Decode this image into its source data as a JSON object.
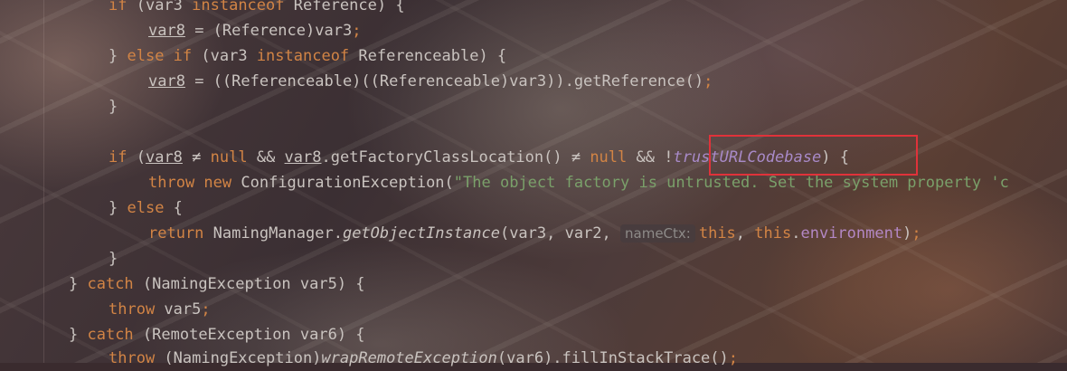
{
  "code": {
    "l1_if": "if",
    "l1_var3": " (var3 ",
    "l1_instanceof": "instanceof",
    "l1_ref": " Reference) {",
    "l2_var8": "var8",
    "l2_rest": " = (Reference)var3",
    "l2_semi": ";",
    "l3_close": "} ",
    "l3_else": "else",
    "l3_if": " if",
    "l3_var3": " (var3 ",
    "l3_instanceof": "instanceof",
    "l3_refable": " Referenceable) {",
    "l4_var8": "var8",
    "l4_rest": " = ((Referenceable)((Referenceable)var3)).getReference()",
    "l4_semi": ";",
    "l5_close": "}",
    "l6_if": "if",
    "l6_paren": " (",
    "l6_var8a": "var8",
    "l6_neq1": " ≠ ",
    "l6_null1": "null",
    "l6_and1": " && ",
    "l6_var8b": "var8",
    "l6_call": ".getFactoryClassLocation() ≠ ",
    "l6_null2": "null",
    "l6_and2": " && !",
    "l6_field": "trustURLCodebase",
    "l6_end": ") {",
    "l7_throw": "throw",
    "l7_new": " new",
    "l7_cls": " ConfigurationException(",
    "l7_str": "\"The object factory is untrusted. Set the system property 'c",
    "l8_close": "} ",
    "l8_else": "else",
    "l8_brace": " {",
    "l9_return": "return",
    "l9_mgr": " NamingManager.",
    "l9_method": "getObjectInstance",
    "l9_args": "(var3, var2, ",
    "l9_hint": "nameCtx:",
    "l9_this1": "this",
    "l9_comma": ", ",
    "l9_this2": "this",
    "l9_dot": ".",
    "l9_env": "environment",
    "l9_end": ")",
    "l9_semi": ";",
    "l10_close": "}",
    "l11_close": "} ",
    "l11_catch": "catch",
    "l11_rest": " (NamingException var5) {",
    "l12_throw": "throw",
    "l12_rest": " var5",
    "l12_semi": ";",
    "l13_close": "} ",
    "l13_catch": "catch",
    "l13_rest": " (RemoteException var6) {",
    "l14_throw": "throw",
    "l14_cast": " (NamingException)",
    "l14_method": "wrapRemoteException",
    "l14_rest": "(var6).fillInStackTrace()",
    "l14_semi": ";"
  },
  "highlight": {
    "color": "#e0323a",
    "target": "trustURLCodebase"
  }
}
